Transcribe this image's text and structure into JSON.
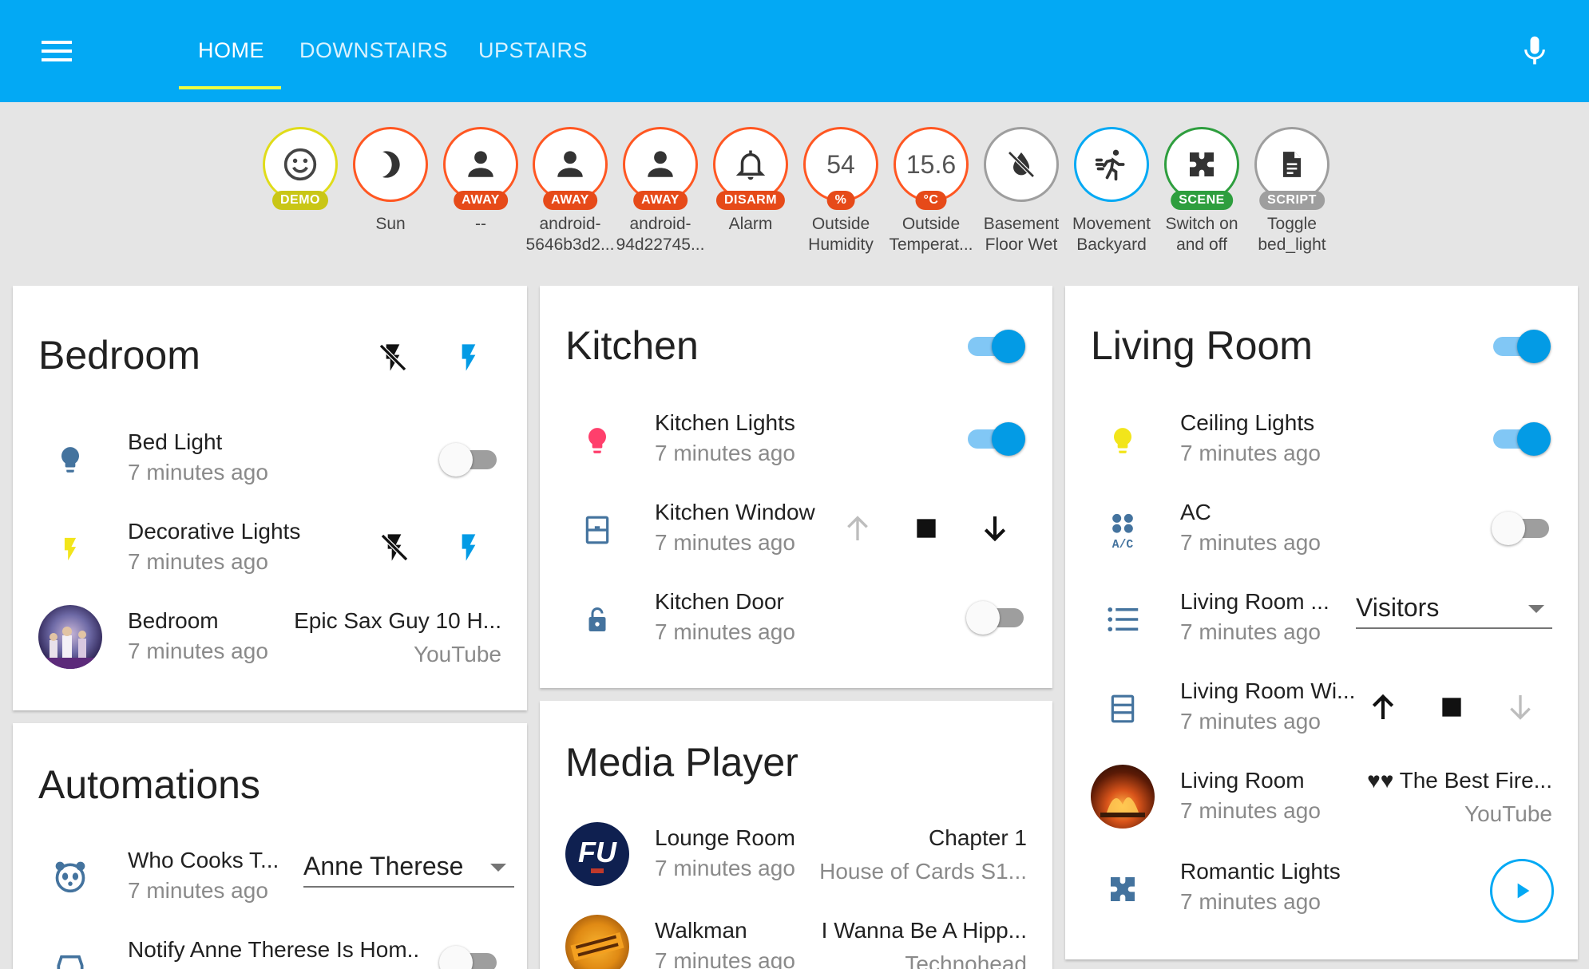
{
  "header": {
    "tabs": [
      {
        "label": "HOME",
        "active": true
      },
      {
        "label": "DOWNSTAIRS",
        "active": false
      },
      {
        "label": "UPSTAIRS",
        "active": false
      }
    ],
    "icons": {
      "menu": "menu-icon",
      "mic": "microphone-icon"
    },
    "colors": {
      "bar": "#03a9f4",
      "indicator": "#eeff41"
    }
  },
  "badges": [
    {
      "icon": "smiley-icon",
      "label": "DEMO",
      "label_color": "#c9c616",
      "ring": "#e0dc1a",
      "name": "",
      "value": ""
    },
    {
      "icon": "moon-icon",
      "label": "",
      "ring": "#ff5722",
      "name": "Sun",
      "value": ""
    },
    {
      "icon": "person-icon",
      "label": "AWAY",
      "label_color": "#e64a19",
      "ring": "#ff5722",
      "name": "--",
      "value": ""
    },
    {
      "icon": "person-icon",
      "label": "AWAY",
      "label_color": "#e64a19",
      "ring": "#ff5722",
      "name": "android-\n5646b3d2...",
      "value": ""
    },
    {
      "icon": "person-icon",
      "label": "AWAY",
      "label_color": "#e64a19",
      "ring": "#ff5722",
      "name": "android-\n94d22745...",
      "value": ""
    },
    {
      "icon": "bell-icon",
      "label": "DISARM",
      "label_color": "#e64a19",
      "ring": "#ff5722",
      "name": "Alarm",
      "value": ""
    },
    {
      "icon": "",
      "label": "%",
      "label_color": "#e64a19",
      "ring": "#ff5722",
      "name": "Outside\nHumidity",
      "value": "54"
    },
    {
      "icon": "",
      "label": "°C",
      "label_color": "#e64a19",
      "ring": "#ff5722",
      "name": "Outside\nTemperat...",
      "value": "15.6"
    },
    {
      "icon": "water-off-icon",
      "label": "",
      "ring": "#9e9e9e",
      "name": "Basement\nFloor Wet",
      "value": ""
    },
    {
      "icon": "run-icon",
      "label": "",
      "ring": "#03a9f4",
      "name": "Movement\nBackyard",
      "value": ""
    },
    {
      "icon": "scene-icon",
      "label": "SCENE",
      "label_color": "#2e9e3e",
      "ring": "#2e9e3e",
      "name": "Switch on\nand off",
      "value": ""
    },
    {
      "icon": "script-icon",
      "label": "SCRIPT",
      "label_color": "#9e9e9e",
      "ring": "#9e9e9e",
      "name": "Toggle\nbed_light",
      "value": ""
    }
  ],
  "bedroom": {
    "title": "Bedroom",
    "rows": [
      {
        "name": "Bed Light",
        "time": "7 minutes ago",
        "icon": "lightbulb-icon",
        "state": "off"
      },
      {
        "name": "Decorative Lights",
        "time": "7 minutes ago",
        "icon": "flash-icon"
      },
      {
        "name": "Bedroom",
        "time": "7 minutes ago",
        "media_title": "Epic Sax Guy 10 H...",
        "media_app": "YouTube"
      }
    ]
  },
  "automations": {
    "title": "Automations",
    "rows": [
      {
        "name": "Who Cooks T...",
        "time": "7 minutes ago",
        "icon": "panda-icon",
        "select": "Anne Therese"
      },
      {
        "name": "Notify Anne Therese Is Hom..",
        "icon": "car-icon"
      }
    ]
  },
  "kitchen": {
    "title": "Kitchen",
    "group_state": "on",
    "rows": [
      {
        "name": "Kitchen Lights",
        "time": "7 minutes ago",
        "icon": "lightbulb-icon",
        "state": "on"
      },
      {
        "name": "Kitchen Window",
        "time": "7 minutes ago",
        "icon": "window-icon"
      },
      {
        "name": "Kitchen Door",
        "time": "7 minutes ago",
        "icon": "lock-open-icon",
        "state": "off"
      }
    ]
  },
  "media_player": {
    "title": "Media Player",
    "rows": [
      {
        "name": "Lounge Room",
        "time": "7 minutes ago",
        "media_title": "Chapter 1",
        "media_sub": "House of Cards S1..."
      },
      {
        "name": "Walkman",
        "time": "7 minutes ago",
        "media_title": "I Wanna Be A Hipp...",
        "media_sub": "Technohead"
      }
    ]
  },
  "living_room": {
    "title": "Living Room",
    "group_state": "on",
    "rows": [
      {
        "name": "Ceiling Lights",
        "time": "7 minutes ago",
        "icon": "lightbulb-icon",
        "state": "on"
      },
      {
        "name": "AC",
        "time": "7 minutes ago",
        "icon": "air-conditioner-icon",
        "state": "off"
      },
      {
        "name": "Living Room ...",
        "time": "7 minutes ago",
        "icon": "format-list-icon",
        "select": "Visitors"
      },
      {
        "name": "Living Room Wi...",
        "time": "7 minutes ago",
        "icon": "window-icon"
      },
      {
        "name": "Living Room",
        "time": "7 minutes ago",
        "media_title": "♥♥ The Best Fire...",
        "media_app": "YouTube"
      },
      {
        "name": "Romantic Lights",
        "time": "7 minutes ago",
        "icon": "scene-icon"
      }
    ]
  },
  "colors": {
    "primary": "#03a9f4",
    "icon_blue": "#44739e",
    "light_pink": "#ff3f6c",
    "light_yellow": "#f2e51b",
    "accent_toggle": "#039be5"
  }
}
